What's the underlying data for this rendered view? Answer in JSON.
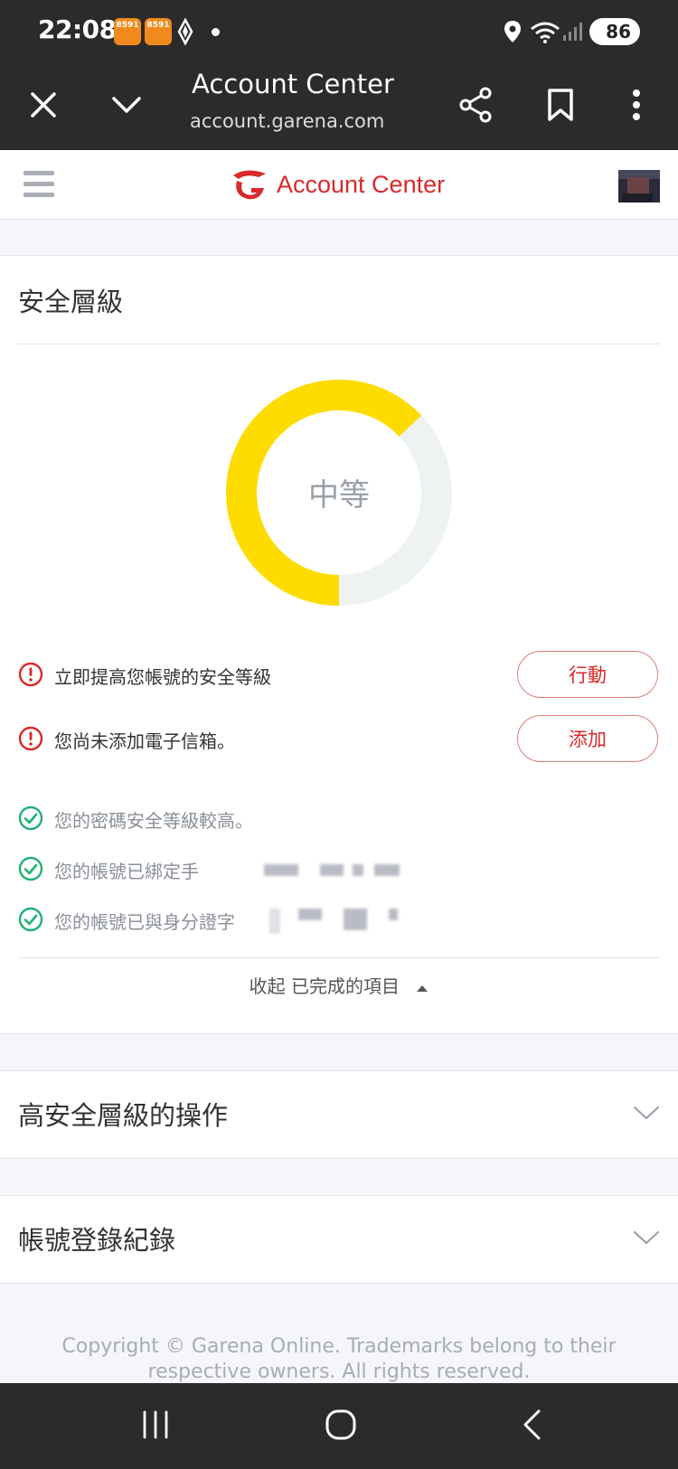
{
  "status_bar": {
    "time": "22:08",
    "app_badges": [
      "8591",
      "8591"
    ],
    "battery": "86",
    "icons": [
      "navigation-icon",
      "location-icon",
      "wifi-icon",
      "signal-icon",
      "battery-icon"
    ]
  },
  "browser": {
    "title": "Account Center",
    "url": "account.garena.com",
    "buttons": [
      "close-icon",
      "chevron-down-icon",
      "share-icon",
      "bookmark-icon",
      "more-icon"
    ]
  },
  "site_header": {
    "brand": "Account Center",
    "brand_color": "#d9292a"
  },
  "security": {
    "title": "安全層級",
    "level": "中等",
    "level_fraction": 0.63,
    "gauge_color": "#ffdc00",
    "gauge_track_color": "#eef2f3",
    "alerts": [
      {
        "text": "立即提高您帳號的安全等級",
        "button": "行動"
      },
      {
        "text": "您尚未添加電子信箱。",
        "button": "添加"
      }
    ],
    "completed": [
      {
        "text": "您的密碼安全等級較高。"
      },
      {
        "text": "您的帳號已綁定手"
      },
      {
        "text": "您的帳號已與身分證字"
      }
    ],
    "collapse_label": "收起 已完成的項目"
  },
  "accordions": [
    {
      "title": "高安全層級的操作"
    },
    {
      "title": "帳號登錄紀錄"
    }
  ],
  "footer": {
    "line1": "Copyright © Garena Online. Trademarks belong to their",
    "line2": "respective owners. All rights reserved."
  },
  "nav_bar": {
    "buttons": [
      "recent-apps-icon",
      "home-icon",
      "back-icon"
    ]
  }
}
